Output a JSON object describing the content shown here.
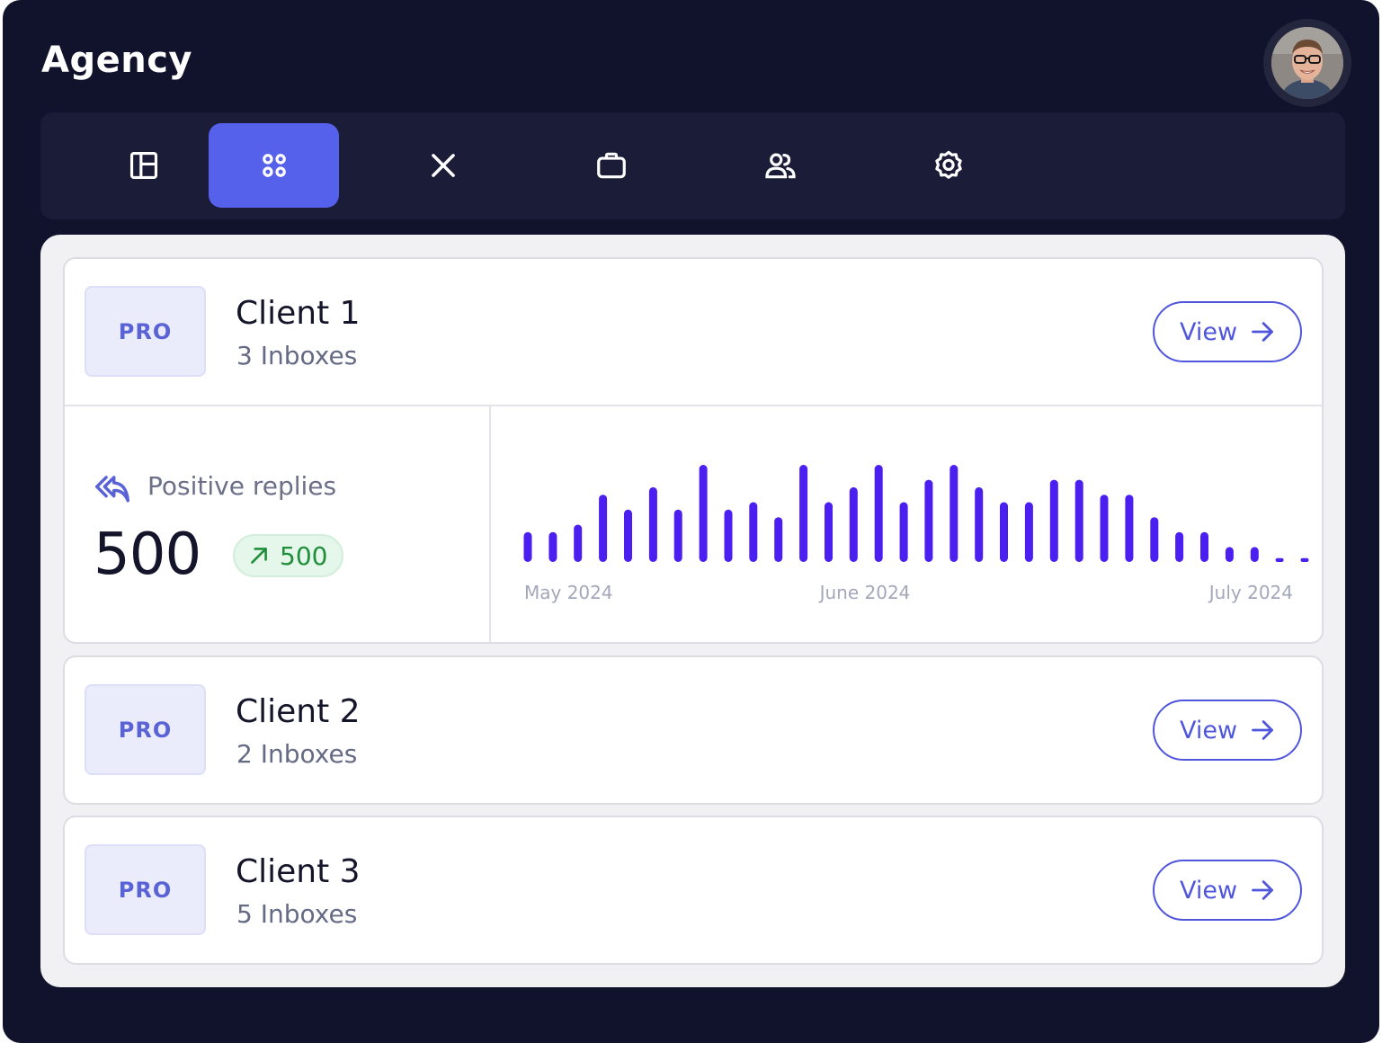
{
  "app": {
    "title": "Agency",
    "avatar_label": "user-avatar"
  },
  "tabs": [
    {
      "icon": "layout-icon",
      "active": false
    },
    {
      "icon": "apps-grid-icon",
      "active": true
    },
    {
      "icon": "close-icon",
      "active": false
    },
    {
      "icon": "briefcase-icon",
      "active": false
    },
    {
      "icon": "users-icon",
      "active": false
    },
    {
      "icon": "settings-gear-icon",
      "active": false
    }
  ],
  "clients": [
    {
      "badge": "PRO",
      "name": "Client 1",
      "inboxes": "3 Inboxes",
      "view_label": "View"
    },
    {
      "badge": "PRO",
      "name": "Client 2",
      "inboxes": "2 Inboxes",
      "view_label": "View"
    },
    {
      "badge": "PRO",
      "name": "Client 3",
      "inboxes": "5 Inboxes",
      "view_label": "View"
    }
  ],
  "stats": {
    "label": "Positive replies",
    "value": "500",
    "delta": "500"
  },
  "colors": {
    "accent": "#5561ea",
    "bar": "#4a1ff0",
    "positive": "#1f8f3c"
  },
  "chart_data": {
    "type": "bar",
    "xticks": [
      "May 2024",
      "June 2024",
      "July 2024"
    ],
    "values": [
      4,
      4,
      5,
      9,
      7,
      10,
      7,
      13,
      7,
      8,
      6,
      13,
      8,
      10,
      13,
      8,
      11,
      13,
      10,
      8,
      8,
      11,
      11,
      9,
      9,
      6,
      4,
      4,
      2,
      2,
      0.5,
      0.5
    ],
    "ylim": [
      0,
      13
    ],
    "grid": false
  }
}
